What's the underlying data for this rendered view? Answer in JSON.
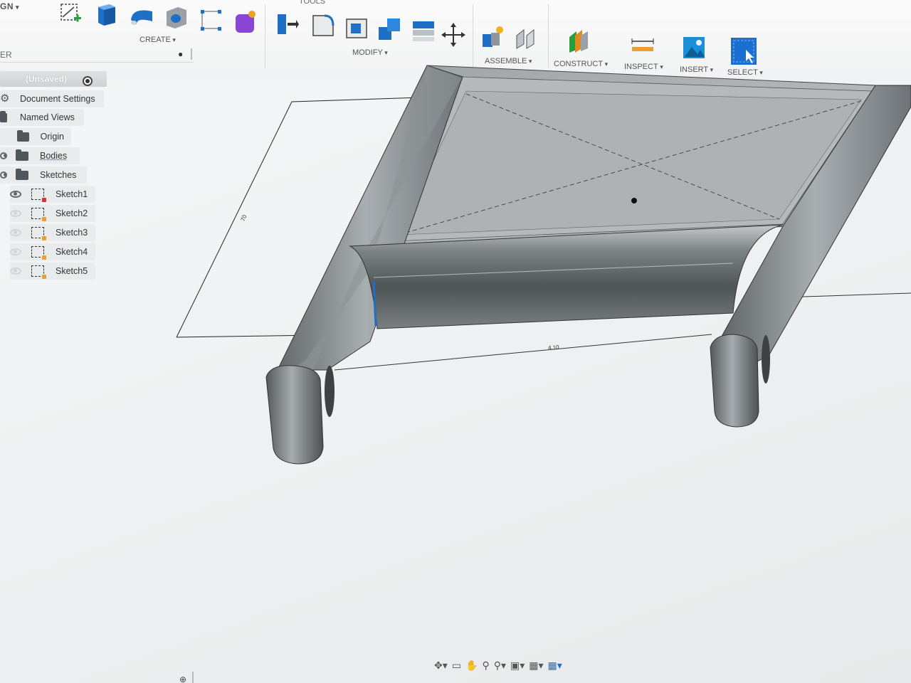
{
  "toolbar": {
    "workspace_label": "GN",
    "tools_label": "TOOLS",
    "groups": {
      "create": "CREATE",
      "modify": "MODIFY",
      "assemble": "ASSEMBLE",
      "construct": "CONSTRUCT",
      "inspect": "INSPECT",
      "insert": "INSERT",
      "select": "SELECT"
    }
  },
  "browser": {
    "header": "ER",
    "root": "(Unsaved)",
    "items": [
      {
        "label": "Document Settings"
      },
      {
        "label": "Named Views"
      },
      {
        "label": "Origin"
      },
      {
        "label": "Bodies"
      },
      {
        "label": "Sketches"
      }
    ],
    "sketches": [
      "Sketch1",
      "Sketch2",
      "Sketch3",
      "Sketch4",
      "Sketch5"
    ]
  },
  "viewport": {
    "dimension_left": "70",
    "dimension_bottom": "4.10"
  },
  "colors": {
    "accent_blue": "#1f6fc4",
    "body_gray": "#8c9194",
    "toolbar_bg": "#f4f5f6"
  }
}
